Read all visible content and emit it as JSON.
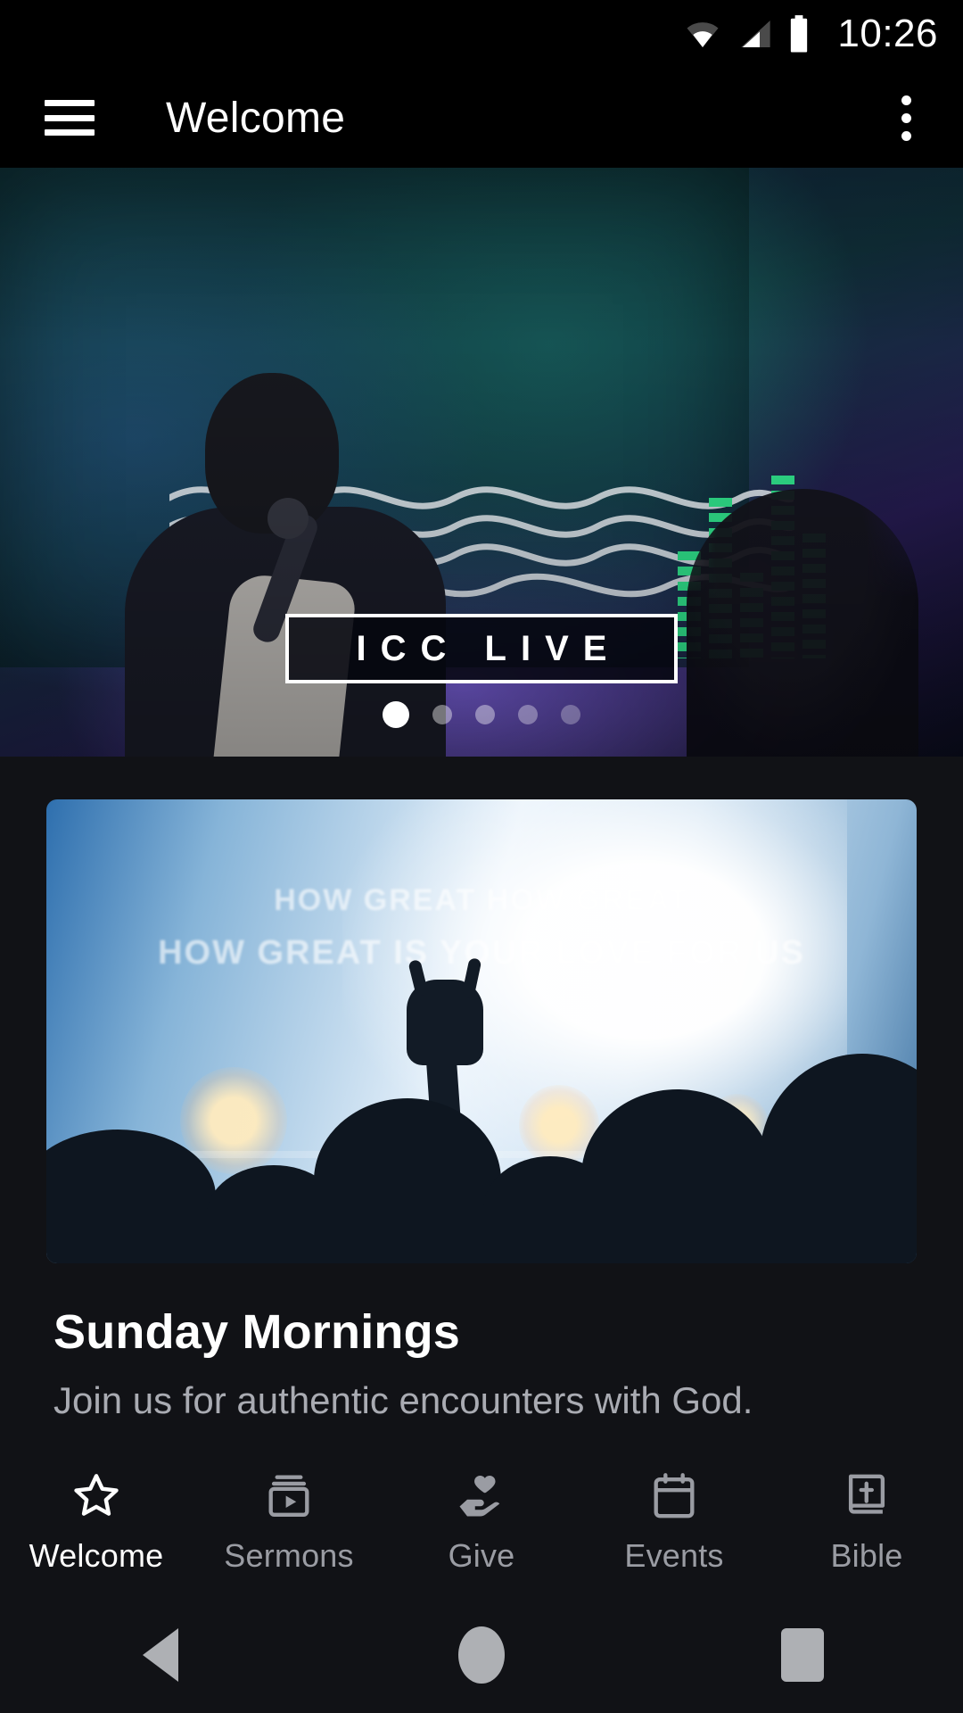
{
  "status_bar": {
    "time": "10:26",
    "icons": [
      "wifi-icon",
      "cellular-signal-icon",
      "battery-icon"
    ]
  },
  "app_bar": {
    "menu_icon": "hamburger-menu-icon",
    "title": "Welcome",
    "overflow_icon": "more-vertical-icon"
  },
  "hero_carousel": {
    "slide_logo_text": "ICC LIVE",
    "slide_alt": "Worship leader singing into a microphone on stage with green LED screen behind",
    "dots_total": 5,
    "active_dot_index": 1
  },
  "feature_card": {
    "image_alt": "Congregation with raised hands in front of a bright worship screen",
    "image_lyrics_line1": "HOW GREAT HOW GREAT",
    "image_lyrics_line2": "HOW GREAT IS YOUR LOVE FOR US",
    "title": "Sunday Mornings",
    "subtitle": "Join us for authentic encounters with God."
  },
  "tab_bar": {
    "active_label": "Welcome",
    "items": [
      {
        "label": "Welcome",
        "icon": "star-icon",
        "active": true
      },
      {
        "label": "Sermons",
        "icon": "video-play-icon",
        "active": false
      },
      {
        "label": "Give",
        "icon": "hand-heart-icon",
        "active": false
      },
      {
        "label": "Events",
        "icon": "calendar-icon",
        "active": false
      },
      {
        "label": "Bible",
        "icon": "book-cross-icon",
        "active": false
      }
    ]
  },
  "system_nav": {
    "back": "back-triangle-icon",
    "home": "home-circle-icon",
    "recents": "recents-square-icon"
  },
  "colors": {
    "background": "#111216",
    "app_bar": "#000000",
    "text_primary": "#ffffff",
    "text_secondary": "#a9abb2",
    "tab_inactive": "#9a9ca3",
    "system_nav_icon": "#aeb0b4"
  }
}
